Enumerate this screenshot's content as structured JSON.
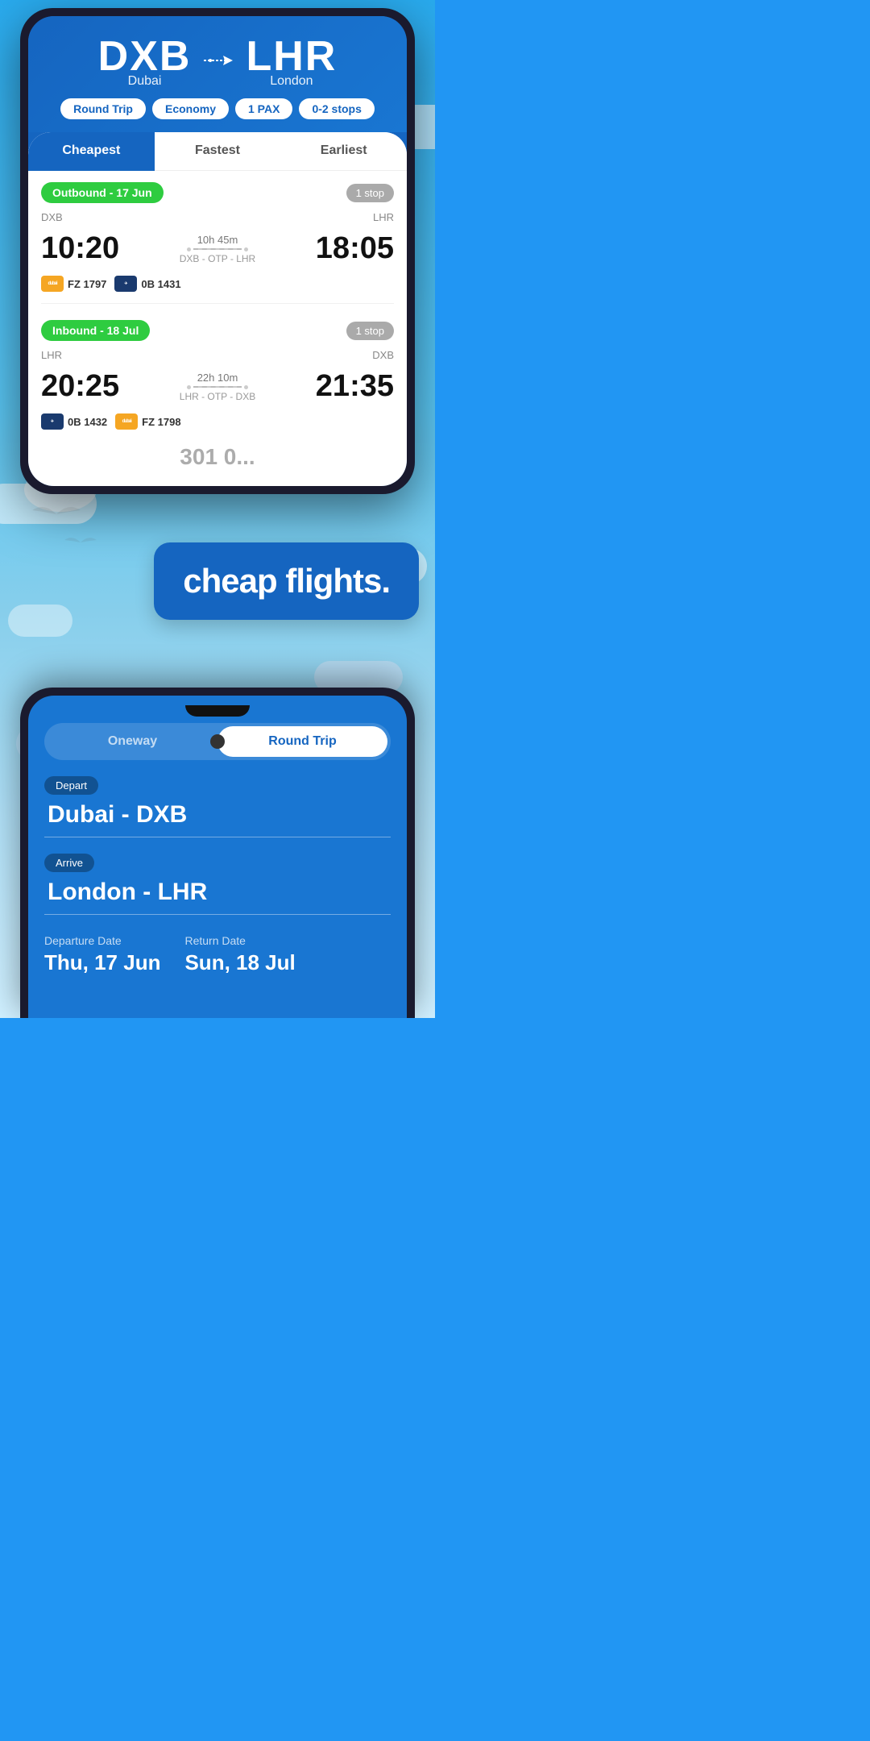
{
  "phone1": {
    "origin_code": "DXB",
    "origin_city": "Dubai",
    "dest_code": "LHR",
    "dest_city": "London",
    "filters": {
      "trip_type": "Round Trip",
      "cabin": "Economy",
      "pax": "1 PAX",
      "stops": "0-2 stops"
    },
    "tabs": {
      "cheapest": "Cheapest",
      "fastest": "Fastest",
      "earliest": "Earliest"
    },
    "outbound": {
      "label": "Outbound - 17 Jun",
      "stop_label": "1 stop",
      "from_code": "DXB",
      "to_code": "LHR",
      "depart_time": "10:20",
      "arrive_time": "18:05",
      "duration": "10h 45m",
      "route": "DXB - OTP - LHR",
      "airline1_code": "FZ 1797",
      "airline1_logo": "dubai",
      "airline2_code": "0B 1431",
      "airline2_logo": "blue"
    },
    "inbound": {
      "label": "Inbound - 18 Jul",
      "stop_label": "1 stop",
      "from_code": "LHR",
      "to_code": "DXB",
      "depart_time": "20:25",
      "arrive_time": "21:35",
      "duration": "22h 10m",
      "route": "LHR - OTP - DXB",
      "airline1_code": "0B 1432",
      "airline1_logo": "blue",
      "airline2_code": "FZ 1798",
      "airline2_logo": "dubai"
    }
  },
  "middle": {
    "tagline": "cheap flights."
  },
  "phone2": {
    "trip_type_oneway": "Oneway",
    "trip_type_round": "Round Trip",
    "depart_label": "Depart",
    "depart_value": "Dubai - DXB",
    "arrive_label": "Arrive",
    "arrive_value": "London - LHR",
    "departure_date_label": "Departure Date",
    "departure_date_value": "Thu, 17 Jun",
    "return_date_label": "Return Date",
    "return_date_value": "Sun, 18 Jul"
  }
}
